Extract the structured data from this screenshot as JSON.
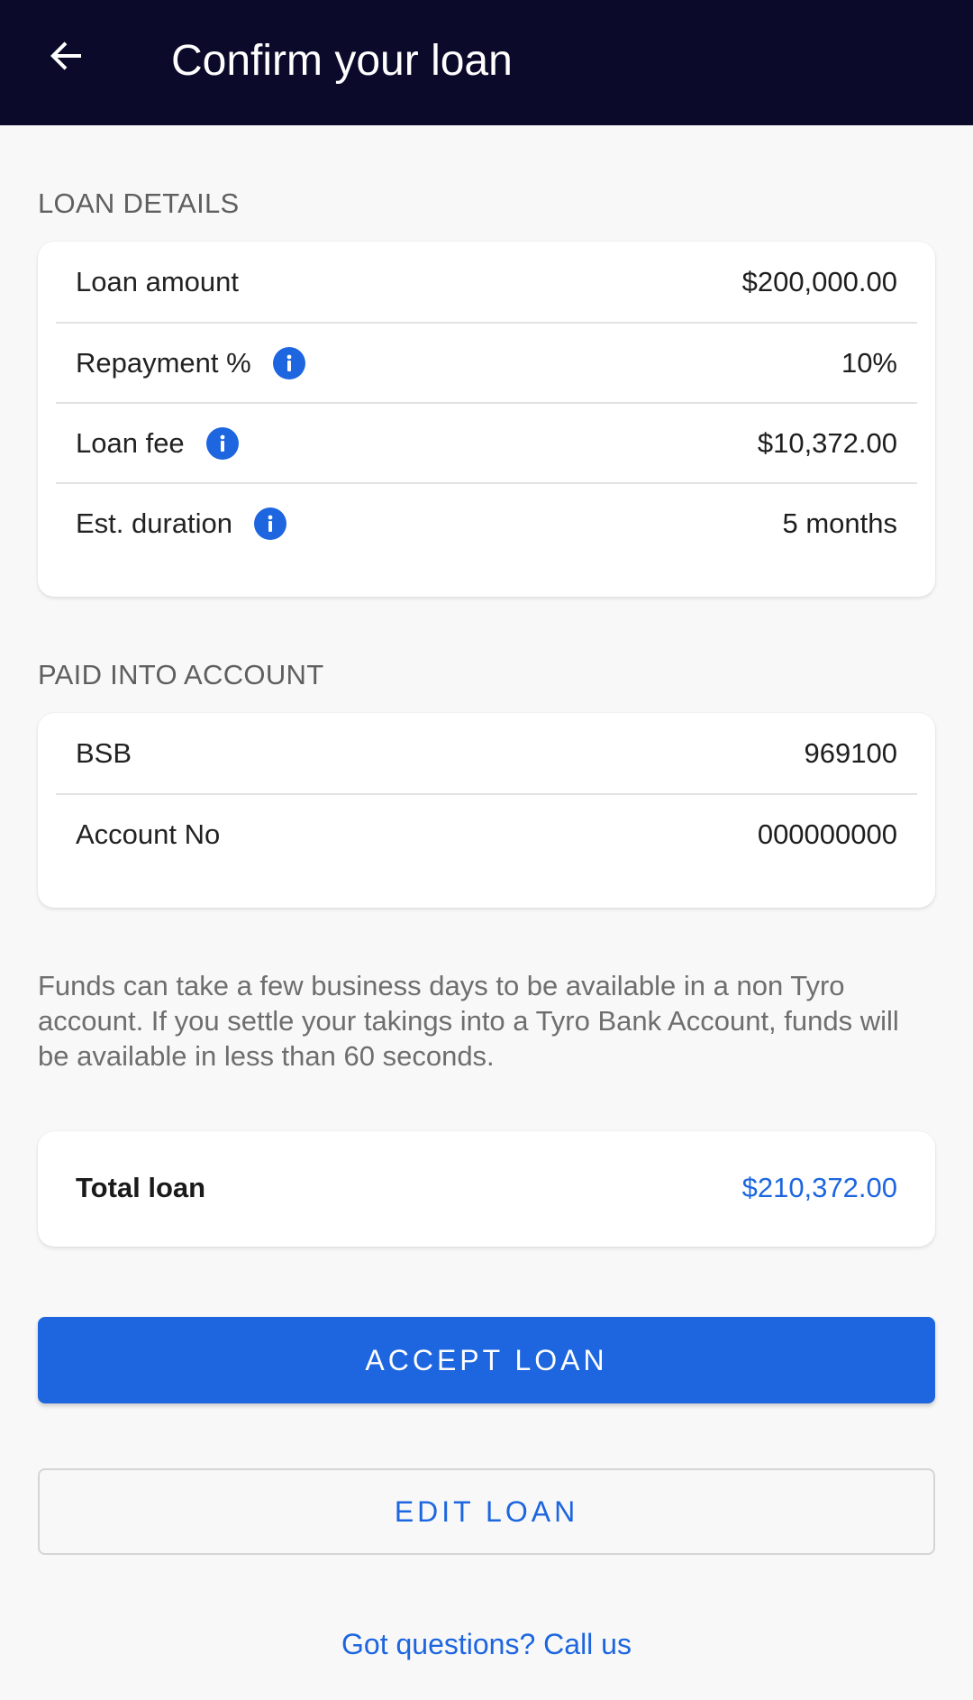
{
  "header": {
    "title": "Confirm your loan",
    "back_icon": "arrow-left-icon"
  },
  "loan_details": {
    "section_label": "LOAN DETAILS",
    "rows": [
      {
        "label": "Loan amount",
        "value": "$200,000.00",
        "info": false
      },
      {
        "label": "Repayment %",
        "value": "10%",
        "info": true
      },
      {
        "label": "Loan fee",
        "value": "$10,372.00",
        "info": true
      },
      {
        "label": "Est. duration",
        "value": "5 months",
        "info": true
      }
    ]
  },
  "account": {
    "section_label": "PAID INTO ACCOUNT",
    "rows": [
      {
        "label": "BSB",
        "value": "969100"
      },
      {
        "label": "Account No",
        "value": "000000000"
      }
    ]
  },
  "note": "Funds can take a few business days to be available in a non Tyro account. If you settle your takings into a Tyro Bank Account, funds will be available in less than 60 seconds.",
  "total": {
    "label": "Total loan",
    "value": "$210,372.00"
  },
  "actions": {
    "accept_label": "ACCEPT LOAN",
    "edit_label": "EDIT LOAN",
    "call_label": "Got questions? Call us"
  },
  "colors": {
    "appbar": "#0b0a2a",
    "accent": "#1d66e0",
    "background": "#f8f8f8"
  }
}
